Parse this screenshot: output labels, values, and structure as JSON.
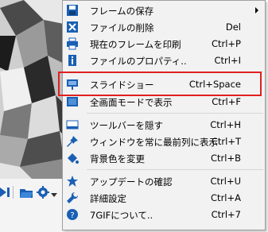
{
  "menu": {
    "items": [
      {
        "label": "フレームの保存",
        "shortcut": "",
        "icon": "floppy-disk-icon",
        "submenu": true
      },
      {
        "label": "ファイルの削除",
        "shortcut": "Del",
        "icon": "delete-x-icon"
      },
      {
        "label": "現在のフレームを印刷",
        "shortcut": "Ctrl+P",
        "icon": "printer-icon"
      },
      {
        "label": "ファイルのプロパティ..",
        "shortcut": "Ctrl+I",
        "icon": "info-icon"
      },
      {
        "label": "スライドショー",
        "shortcut": "Ctrl+Space",
        "icon": "slideshow-icon"
      },
      {
        "label": "全画面モードで表示",
        "shortcut": "Ctrl+F",
        "icon": "fullscreen-icon"
      },
      {
        "label": "ツールバーを隠す",
        "shortcut": "Ctrl+H",
        "icon": "toolbar-icon"
      },
      {
        "label": "ウィンドウを常に最前列に表示",
        "shortcut": "Ctrl+T",
        "icon": "pin-icon"
      },
      {
        "label": "背景色を変更",
        "shortcut": "Ctrl+B",
        "icon": "paint-bucket-icon"
      },
      {
        "label": "アップデートの確認",
        "shortcut": "Ctrl+U",
        "icon": "star-icon"
      },
      {
        "label": "詳細設定",
        "shortcut": "Ctrl+A",
        "icon": "wrench-icon"
      },
      {
        "label": "7GIFについて..",
        "shortcut": "Ctrl+7",
        "icon": "help-icon"
      }
    ]
  },
  "colors": {
    "highlight_border": "#e02020",
    "icon_blue": "#1a5fb4"
  }
}
